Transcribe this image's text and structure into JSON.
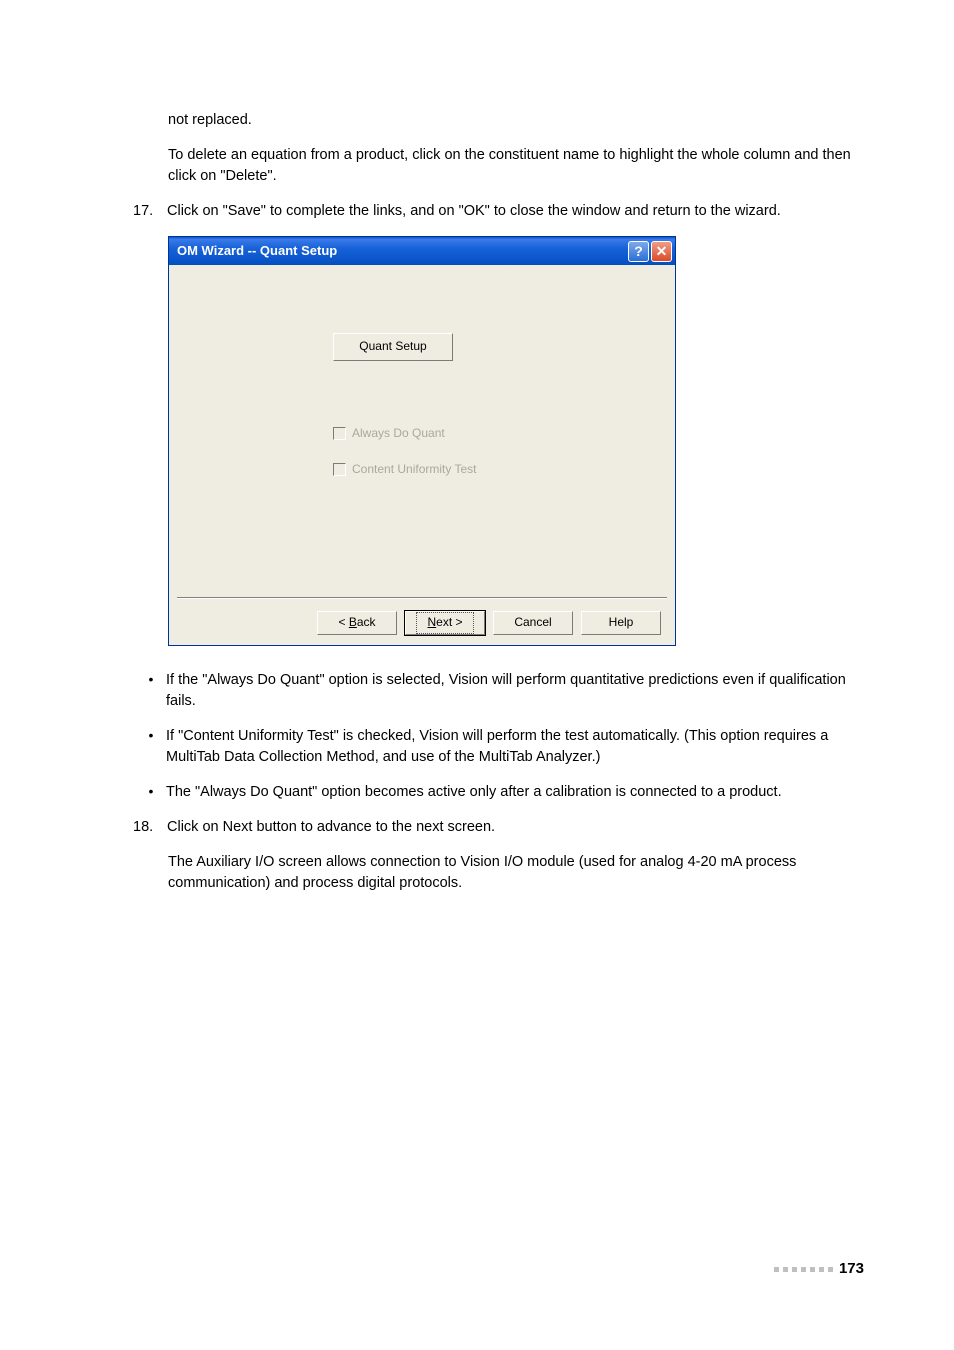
{
  "para_not_replaced": "not replaced.",
  "para_delete_eq": "To delete an equation from a product, click on the constituent name to highlight the whole column and then click on \"Delete\".",
  "step17_num": "17.",
  "step17_text": "Click on \"Save\" to complete the links, and on \"OK\" to close the window and return to the wizard.",
  "dialog": {
    "title": "OM Wizard -- Quant Setup",
    "help_glyph": "?",
    "close_glyph": "✕",
    "quant_setup_btn": "Quant Setup",
    "chk_always": "Always Do Quant",
    "chk_content": "Content Uniformity Test",
    "back_pre": "< ",
    "back_u": "B",
    "back_post": "ack",
    "next_u": "N",
    "next_post": "ext >",
    "cancel": "Cancel",
    "help": "Help"
  },
  "bullet1": "If the \"Always Do Quant\" option is selected, Vision will perform quantitative predictions even if qualification fails.",
  "bullet2": "If \"Content Uniformity Test\" is checked, Vision will perform the test automatically. (This option requires a MultiTab Data Collection Method, and use of the MultiTab Analyzer.)",
  "bullet3": "The \"Always Do Quant\" option becomes active only after a calibration is connected to a product.",
  "step18_num": "18.",
  "step18_text": "Click on Next button to advance to the next screen.",
  "aux_para": "The Auxiliary I/O screen allows connection to Vision I/O module (used for analog 4-20 mA process communication) and process digital protocols.",
  "page_number": "173",
  "bullet_char": "•"
}
